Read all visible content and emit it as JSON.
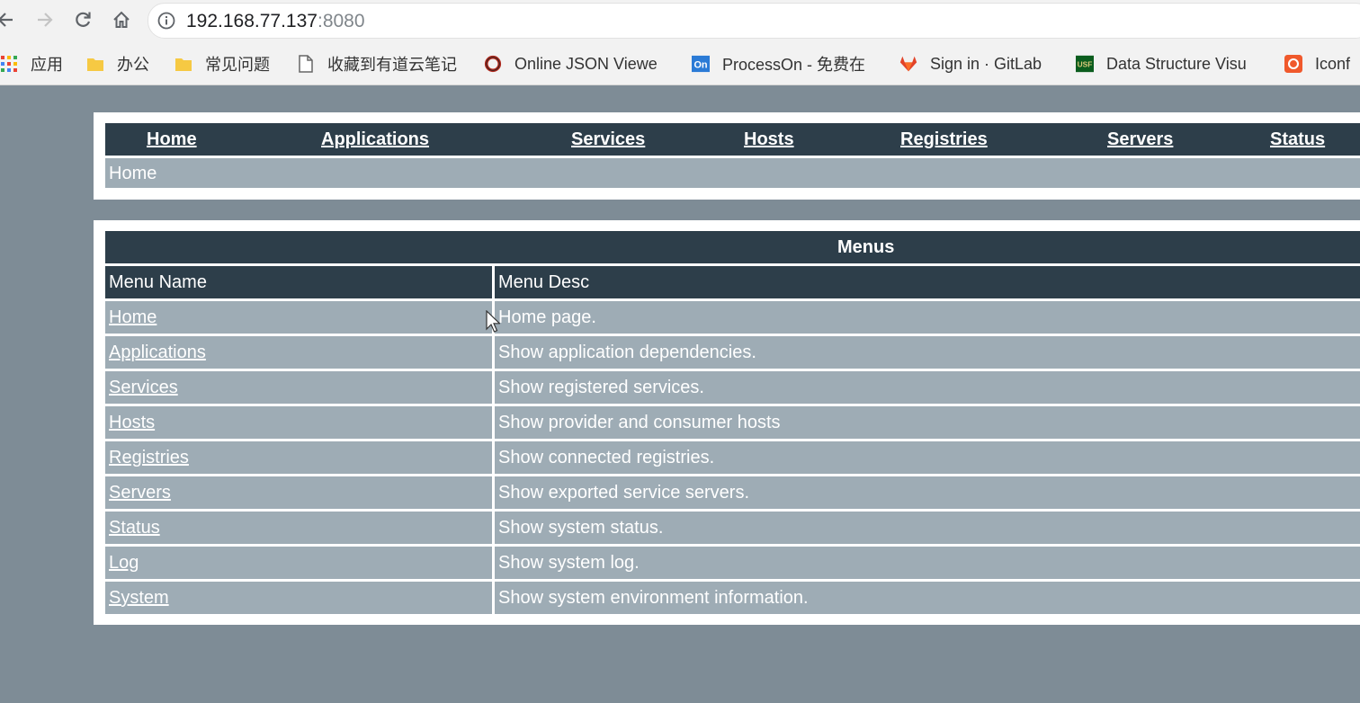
{
  "browser": {
    "url_host": "192.168.77.137",
    "url_port": ":8080",
    "bookmarks": [
      {
        "label": "应用",
        "icon": "apps-grid-icon"
      },
      {
        "label": "办公",
        "icon": "folder-icon"
      },
      {
        "label": "常见问题",
        "icon": "folder-icon"
      },
      {
        "label": "收藏到有道云笔记",
        "icon": "page-icon"
      },
      {
        "label": "Online JSON Viewe",
        "icon": "ring-icon"
      },
      {
        "label": "ProcessOn - 免费在",
        "icon": "processon-icon"
      },
      {
        "label": "Sign in · GitLab",
        "icon": "gitlab-icon"
      },
      {
        "label": "Data Structure Visu",
        "icon": "usf-icon"
      },
      {
        "label": "Iconf",
        "icon": "iconfont-icon"
      }
    ]
  },
  "nav": {
    "links": [
      "Home",
      "Applications",
      "Services",
      "Hosts",
      "Registries",
      "Servers",
      "Status"
    ],
    "breadcrumb": "Home"
  },
  "menus": {
    "title": "Menus",
    "headers": [
      "Menu Name",
      "Menu Desc"
    ],
    "rows": [
      {
        "name": "Home",
        "desc": "Home page."
      },
      {
        "name": "Applications",
        "desc": "Show application dependencies."
      },
      {
        "name": "Services",
        "desc": "Show registered services."
      },
      {
        "name": "Hosts",
        "desc": "Show provider and consumer hosts"
      },
      {
        "name": "Registries",
        "desc": "Show connected registries."
      },
      {
        "name": "Servers",
        "desc": "Show exported service servers."
      },
      {
        "name": "Status",
        "desc": "Show system status."
      },
      {
        "name": "Log",
        "desc": "Show system log."
      },
      {
        "name": "System",
        "desc": "Show system environment information."
      }
    ]
  },
  "colors": {
    "page_bg": "#7e8c96",
    "header_bg": "#2d3e4a",
    "row_bg": "#9eacb5",
    "panel_bg": "#ffffff"
  }
}
